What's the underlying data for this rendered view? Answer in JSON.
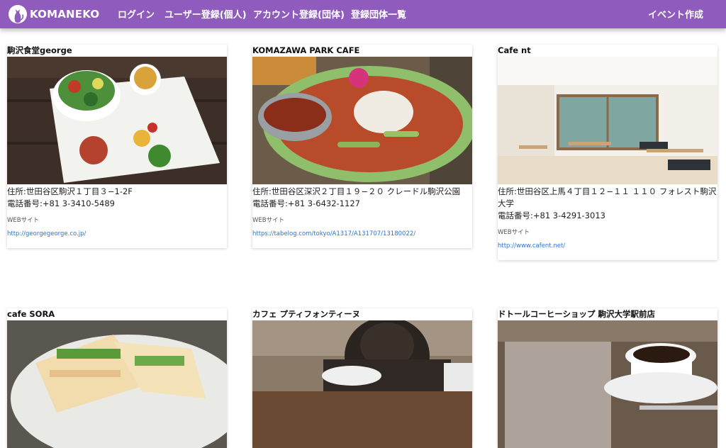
{
  "navbar": {
    "brand": "KOMANEKO",
    "brand_icon": "cat-logo-icon",
    "links": [
      "ログイン",
      "ユーザー登録(個人)",
      "アカウント登録(団体)",
      "登録団体一覧"
    ],
    "create_event": "イベント作成",
    "bg_color": "#8f5cbe"
  },
  "cards": [
    {
      "name": "駒沢食堂george",
      "address": "住所:世田谷区駒沢１丁目３−1-2F",
      "phone": "電話番号:+81 3-3410-5489",
      "web_label": "WEBサイト",
      "web_url": "http://georgegeorge.co.jp/"
    },
    {
      "name": "KOMAZAWA PARK CAFE",
      "address": "住所:世田谷区深沢２丁目１９−２０ クレードル駒沢公園",
      "phone": "電話番号:+81 3-6432-1127",
      "web_label": "WEBサイト",
      "web_url": "https://tabelog.com/tokyo/A1317/A131707/13180022/"
    },
    {
      "name": "Cafe nt",
      "address": "住所:世田谷区上馬４丁目１２−１１ １１０ フォレスト駒沢大学",
      "phone": "電話番号:+81 3-4291-3013",
      "web_label": "WEBサイト",
      "web_url": "http://www.cafent.net/"
    },
    {
      "name": "cafe SORA"
    },
    {
      "name": "カフェ プティフォンティーヌ"
    },
    {
      "name": "ドトールコーヒーショップ 駒沢大学駅前店"
    }
  ]
}
